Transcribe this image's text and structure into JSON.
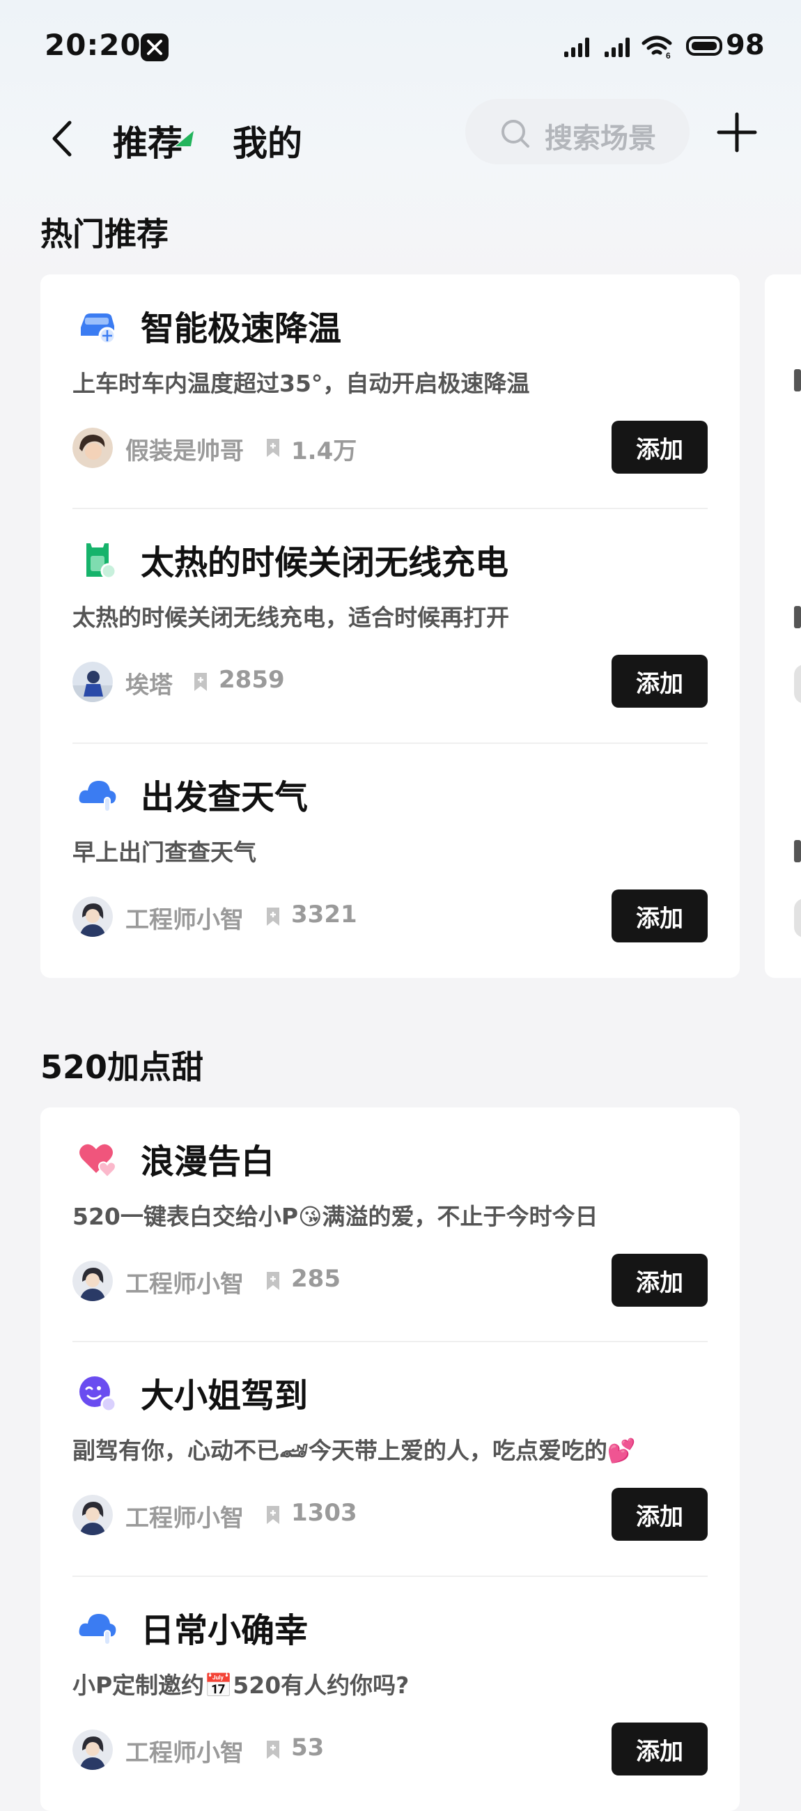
{
  "status_bar": {
    "time": "20:20",
    "battery": "98"
  },
  "nav": {
    "tabs": [
      {
        "label": "推荐",
        "active": true
      },
      {
        "label": "我的",
        "active": false
      }
    ],
    "search_placeholder": "搜索场景"
  },
  "sections": [
    {
      "title": "热门推荐",
      "items": [
        {
          "title": "智能极速降温",
          "desc": "上车时车内温度超过35°，自动开启极速降温",
          "author": "假装是帅哥",
          "count": "1.4万",
          "icon": "car-cool-icon",
          "button": "添加"
        },
        {
          "title": "太热的时候关闭无线充电",
          "desc": "太热的时候关闭无线充电，适合时候再打开",
          "author": "埃塔",
          "count": "2859",
          "icon": "charger-icon",
          "button": "添加"
        },
        {
          "title": "出发查天气",
          "desc": "早上出门查查天气",
          "author": "工程师小智",
          "count": "3321",
          "icon": "weather-icon",
          "button": "添加"
        }
      ]
    },
    {
      "title": "520加点甜",
      "items": [
        {
          "title": "浪漫告白",
          "desc": "520一键表白交给小P😘满溢的爱，不止于今时今日",
          "author": "工程师小智",
          "count": "285",
          "icon": "hearts-icon",
          "button": "添加"
        },
        {
          "title": "大小姐驾到",
          "desc": "副驾有你，心动不已🏎今天带上爱的人，吃点爱吃的💕",
          "author": "工程师小智",
          "count": "1303",
          "icon": "wink-face-icon",
          "button": "添加"
        },
        {
          "title": "日常小确幸",
          "desc": "小P定制邀约📅520有人约你吗?",
          "author": "工程师小智",
          "count": "53",
          "icon": "weather-icon",
          "button": "添加"
        }
      ]
    }
  ],
  "colors": {
    "accent_blue": "#3b7cf2",
    "accent_green": "#16b36b",
    "accent_pink": "#f0557c",
    "accent_purple": "#6a4cf0",
    "button_bg": "#151515"
  }
}
